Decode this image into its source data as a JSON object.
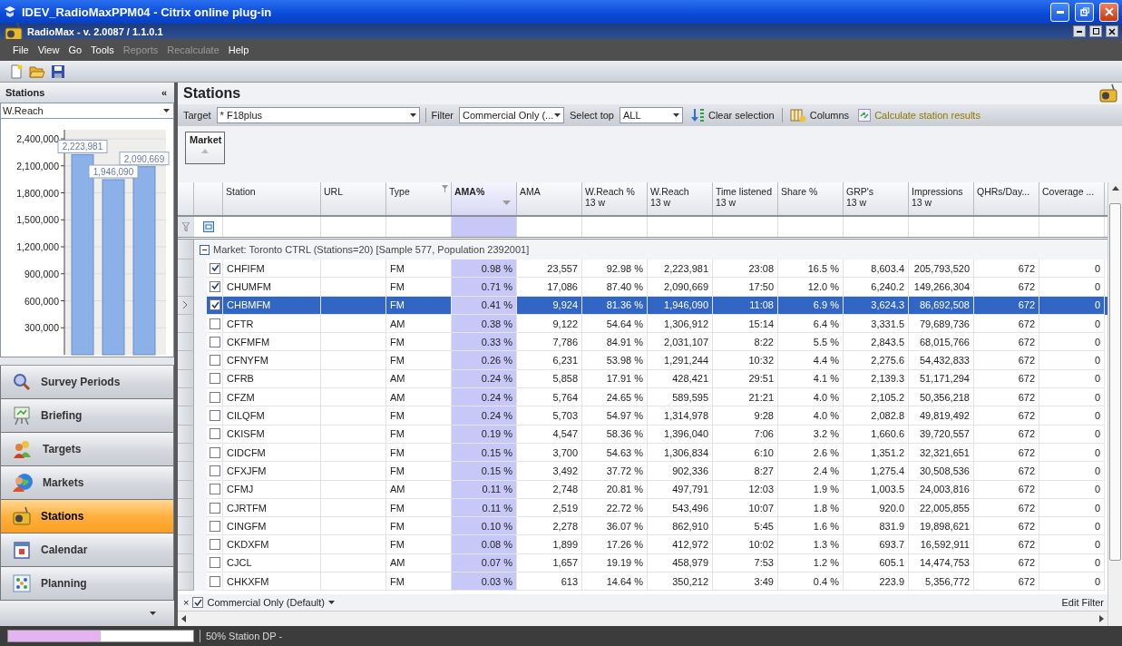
{
  "window": {
    "title": "IDEV_RadioMaxPPM04 - Citrix online plug-in"
  },
  "app": {
    "title": "RadioMax - v. 2.0087 / 1.1.0.1"
  },
  "menu": [
    {
      "label": "File",
      "disabled": false
    },
    {
      "label": "View",
      "disabled": false
    },
    {
      "label": "Go",
      "disabled": false
    },
    {
      "label": "Tools",
      "disabled": false
    },
    {
      "label": "Reports",
      "disabled": true
    },
    {
      "label": "Recalculate",
      "disabled": true
    },
    {
      "label": "Help",
      "disabled": false
    }
  ],
  "sidebar": {
    "title": "Stations",
    "collapse": "«",
    "measure": "W.Reach",
    "chart_data": {
      "type": "bar",
      "values": [
        2223981,
        1946090,
        2090669
      ],
      "data_labels": true,
      "grid": true,
      "value_labels": [
        "2,223,981",
        "1,946,090",
        "2,090,669"
      ],
      "ylim": [
        0,
        2400000
      ],
      "yticks": [
        {
          "value": 300000,
          "label": "300,000"
        },
        {
          "value": 600000,
          "label": "600,000"
        },
        {
          "value": 900000,
          "label": "900,000"
        },
        {
          "value": 1200000,
          "label": "1,200,000"
        },
        {
          "value": 1500000,
          "label": "1,500,000"
        },
        {
          "value": 1800000,
          "label": "1,800,000"
        },
        {
          "value": 2100000,
          "label": "2,100,000"
        },
        {
          "value": 2400000,
          "label": "2,400,000"
        }
      ]
    },
    "nav": [
      {
        "label": "Survey Periods",
        "kind": "survey",
        "selected": false
      },
      {
        "label": "Briefing",
        "kind": "briefing",
        "selected": false
      },
      {
        "label": "Targets",
        "kind": "targets",
        "selected": false
      },
      {
        "label": "Markets",
        "kind": "markets",
        "selected": false
      },
      {
        "label": "Stations",
        "kind": "stations",
        "selected": true
      },
      {
        "label": "Calendar",
        "kind": "calendar",
        "selected": false
      },
      {
        "label": "Planning",
        "kind": "planning",
        "selected": false
      }
    ]
  },
  "main": {
    "title": "Stations",
    "toolbar": {
      "target_label": "Target",
      "target": "* F18plus",
      "filter_label": "Filter",
      "filter": "Commercial Only (...",
      "select_top_label": "Select top",
      "select_top": "ALL",
      "clear": "Clear selection",
      "columns": "Columns",
      "calculate": {
        "label": "Calculate station results",
        "disabled": true
      }
    },
    "group_by": "Market",
    "table": {
      "columns": [
        {
          "label": "Station",
          "kind": "text"
        },
        {
          "label": "URL",
          "kind": "text"
        },
        {
          "label": "Type",
          "kind": "text",
          "filter": true
        },
        {
          "label": "AMA%",
          "kind": "highlight",
          "sorted": true
        },
        {
          "label": "AMA",
          "kind": "number"
        },
        {
          "label": "W.Reach %",
          "sublabel": "13 w",
          "kind": "number"
        },
        {
          "label": "W.Reach",
          "sublabel": "13 w",
          "kind": "number"
        },
        {
          "label": "Time listened",
          "sublabel": "13 w",
          "kind": "number"
        },
        {
          "label": "Share %",
          "kind": "number"
        },
        {
          "label": "GRP's",
          "sublabel": "13 w",
          "kind": "number"
        },
        {
          "label": "Impressions",
          "sublabel": "13 w",
          "kind": "number"
        },
        {
          "label": "QHRs/Day...",
          "kind": "number"
        },
        {
          "label": "Coverage ...",
          "kind": "number"
        }
      ],
      "group": {
        "label": "Market: Toronto CTRL (Stations=20) [Sample 577, Population 2392001]",
        "expanded": true
      },
      "rows": [
        {
          "station": "CHFIFM",
          "checked": true,
          "selected": false,
          "type": "FM",
          "values": [
            "0.98 %",
            "23,557",
            "92.98 %",
            "2,223,981",
            "23:08",
            "16.5 %",
            "8,603.4",
            "205,793,520",
            "672",
            "0"
          ]
        },
        {
          "station": "CHUMFM",
          "checked": true,
          "selected": false,
          "type": "FM",
          "values": [
            "0.71 %",
            "17,086",
            "87.40 %",
            "2,090,669",
            "17:50",
            "12.0 %",
            "6,240.2",
            "149,266,304",
            "672",
            "0"
          ]
        },
        {
          "station": "CHBMFM",
          "checked": true,
          "selected": true,
          "type": "FM",
          "values": [
            "0.41 %",
            "9,924",
            "81.36 %",
            "1,946,090",
            "11:08",
            "6.9 %",
            "3,624.3",
            "86,692,508",
            "672",
            "0"
          ]
        },
        {
          "station": "CFTR",
          "checked": false,
          "selected": false,
          "type": "AM",
          "values": [
            "0.38 %",
            "9,122",
            "54.64 %",
            "1,306,912",
            "15:14",
            "6.4 %",
            "3,331.5",
            "79,689,736",
            "672",
            "0"
          ]
        },
        {
          "station": "CKFMFM",
          "checked": false,
          "selected": false,
          "type": "FM",
          "values": [
            "0.33 %",
            "7,786",
            "84.91 %",
            "2,031,107",
            "8:22",
            "5.5 %",
            "2,843.5",
            "68,015,766",
            "672",
            "0"
          ]
        },
        {
          "station": "CFNYFM",
          "checked": false,
          "selected": false,
          "type": "FM",
          "values": [
            "0.26 %",
            "6,231",
            "53.98 %",
            "1,291,244",
            "10:32",
            "4.4 %",
            "2,275.6",
            "54,432,833",
            "672",
            "0"
          ]
        },
        {
          "station": "CFRB",
          "checked": false,
          "selected": false,
          "type": "AM",
          "values": [
            "0.24 %",
            "5,858",
            "17.91 %",
            "428,421",
            "29:51",
            "4.1 %",
            "2,139.3",
            "51,171,294",
            "672",
            "0"
          ]
        },
        {
          "station": "CFZM",
          "checked": false,
          "selected": false,
          "type": "AM",
          "values": [
            "0.24 %",
            "5,764",
            "24.65 %",
            "589,595",
            "21:21",
            "4.0 %",
            "2,105.2",
            "50,356,218",
            "672",
            "0"
          ]
        },
        {
          "station": "CILQFM",
          "checked": false,
          "selected": false,
          "type": "FM",
          "values": [
            "0.24 %",
            "5,703",
            "54.97 %",
            "1,314,978",
            "9:28",
            "4.0 %",
            "2,082.8",
            "49,819,492",
            "672",
            "0"
          ]
        },
        {
          "station": "CKISFM",
          "checked": false,
          "selected": false,
          "type": "FM",
          "values": [
            "0.19 %",
            "4,547",
            "58.36 %",
            "1,396,040",
            "7:06",
            "3.2 %",
            "1,660.6",
            "39,720,557",
            "672",
            "0"
          ]
        },
        {
          "station": "CIDCFM",
          "checked": false,
          "selected": false,
          "type": "FM",
          "values": [
            "0.15 %",
            "3,700",
            "54.63 %",
            "1,306,834",
            "6:10",
            "2.6 %",
            "1,351.2",
            "32,321,651",
            "672",
            "0"
          ]
        },
        {
          "station": "CFXJFM",
          "checked": false,
          "selected": false,
          "type": "FM",
          "values": [
            "0.15 %",
            "3,492",
            "37.72 %",
            "902,336",
            "8:27",
            "2.4 %",
            "1,275.4",
            "30,508,536",
            "672",
            "0"
          ]
        },
        {
          "station": "CFMJ",
          "checked": false,
          "selected": false,
          "type": "AM",
          "values": [
            "0.11 %",
            "2,748",
            "20.81 %",
            "497,791",
            "12:03",
            "1.9 %",
            "1,003.5",
            "24,003,816",
            "672",
            "0"
          ]
        },
        {
          "station": "CJRTFM",
          "checked": false,
          "selected": false,
          "type": "FM",
          "values": [
            "0.11 %",
            "2,519",
            "22.72 %",
            "543,496",
            "10:07",
            "1.8 %",
            "920.0",
            "22,005,855",
            "672",
            "0"
          ]
        },
        {
          "station": "CINGFM",
          "checked": false,
          "selected": false,
          "type": "FM",
          "values": [
            "0.10 %",
            "2,278",
            "36.07 %",
            "862,910",
            "5:45",
            "1.6 %",
            "831.9",
            "19,898,621",
            "672",
            "0"
          ]
        },
        {
          "station": "CKDXFM",
          "checked": false,
          "selected": false,
          "type": "FM",
          "values": [
            "0.08 %",
            "1,899",
            "17.26 %",
            "412,972",
            "10:02",
            "1.3 %",
            "693.7",
            "16,592,911",
            "672",
            "0"
          ]
        },
        {
          "station": "CJCL",
          "checked": false,
          "selected": false,
          "type": "AM",
          "values": [
            "0.07 %",
            "1,657",
            "19.19 %",
            "458,979",
            "7:53",
            "1.2 %",
            "605.1",
            "14,474,753",
            "672",
            "0"
          ]
        },
        {
          "station": "CHKXFM",
          "checked": false,
          "selected": false,
          "type": "FM",
          "values": [
            "0.03 %",
            "613",
            "14.64 %",
            "350,212",
            "3:49",
            "0.4 %",
            "223.9",
            "5,356,772",
            "672",
            "0"
          ]
        }
      ]
    },
    "filter_bar": {
      "close": "×",
      "checked": true,
      "label": "Commercial Only (Default)",
      "edit": "Edit Filter"
    }
  },
  "status_bar": {
    "level": 0.5,
    "text": "50% Station DP -"
  }
}
